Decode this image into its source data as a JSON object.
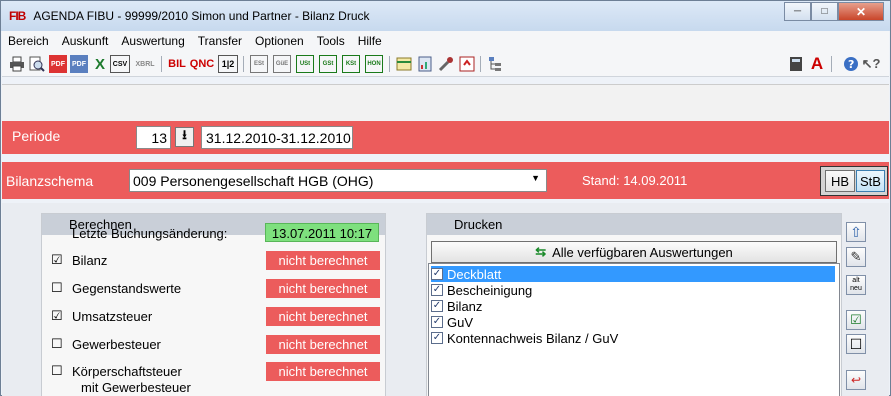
{
  "window": {
    "app_logo": "FIB",
    "title": "AGENDA FIBU - 99999/2010 Simon und Partner - Bilanz Druck",
    "minimize": "─",
    "maximize": "□",
    "close": "✕"
  },
  "menu": [
    "Bereich",
    "Auskunft",
    "Auswertung",
    "Transfer",
    "Optionen",
    "Tools",
    "Hilfe"
  ],
  "toolbar": {
    "csv": "CSV",
    "xbrl": "XBRL",
    "bil": "BIL",
    "qnc": "QNC",
    "onetwo": "1|2",
    "est": "ESt",
    "gue": "GüE",
    "ust": "USt",
    "gst": "GSt",
    "kst": "KSt",
    "hon": "HON"
  },
  "periode": {
    "label": "Periode",
    "value": "13",
    "range": "31.12.2010-31.12.2010"
  },
  "bilanzschema": {
    "label": "Bilanzschema",
    "value": "009 Personengesellschaft HGB (OHG)",
    "stand": "Stand: 14.09.2011",
    "hb": "HB",
    "stb": "StB"
  },
  "berechnen": {
    "header": "Berechnen",
    "letzte_label": "Letzte Buchungsänderung:",
    "letzte_value": "13.07.2011 10:17",
    "items": [
      {
        "label": "Bilanz",
        "checked": true,
        "status": "nicht berechnet"
      },
      {
        "label": "Gegenstandswerte",
        "checked": false,
        "status": "nicht berechnet"
      },
      {
        "label": "Umsatzsteuer",
        "checked": true,
        "status": "nicht berechnet"
      },
      {
        "label": "Gewerbesteuer",
        "checked": false,
        "status": "nicht berechnet"
      },
      {
        "label": "Körperschaftsteuer",
        "label2": "mit Gewerbesteuer",
        "checked": false,
        "status": "nicht berechnet"
      }
    ]
  },
  "drucken": {
    "header": "Drucken",
    "all_button": "Alle verfügbaren Auswertungen",
    "items": [
      {
        "label": "Deckblatt",
        "checked": true,
        "selected": true
      },
      {
        "label": "Bescheinigung",
        "checked": true,
        "selected": false
      },
      {
        "label": "Bilanz",
        "checked": true,
        "selected": false
      },
      {
        "label": "GuV",
        "checked": true,
        "selected": false
      },
      {
        "label": "Kontennachweis Bilanz / GuV",
        "checked": true,
        "selected": false
      }
    ],
    "side_alt": "alt neu"
  },
  "colors": {
    "band": "#ec5c5c",
    "green_badge": "#7ee07e",
    "selection": "#3399ff"
  }
}
